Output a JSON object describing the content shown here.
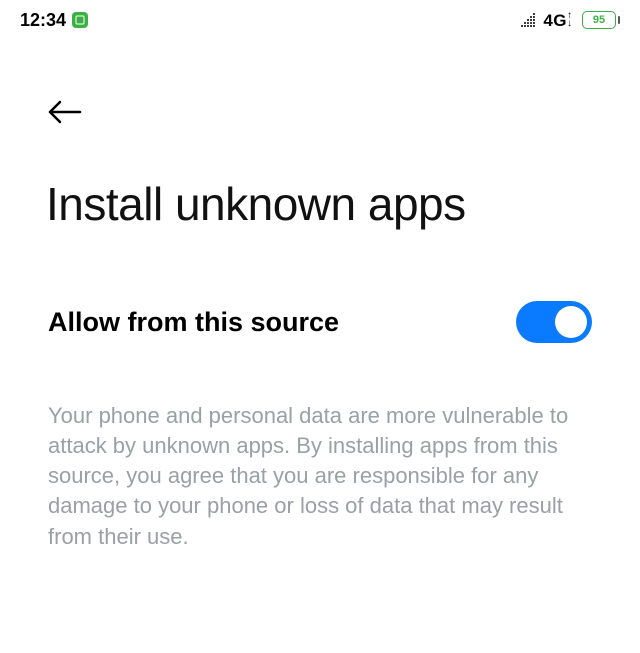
{
  "status": {
    "time": "12:34",
    "network": "4G",
    "network_suffix_top": "+",
    "network_suffix_bot": "↑↓",
    "battery_percent": "95"
  },
  "nav": {
    "back": "Back"
  },
  "page": {
    "title": "Install unknown apps"
  },
  "setting": {
    "label": "Allow from this source",
    "enabled": true
  },
  "description": "Your phone and personal data are more vulnerable to attack by unknown apps. By installing apps from this source, you agree that you are responsible for any damage to your phone or loss of data that may result from their use."
}
